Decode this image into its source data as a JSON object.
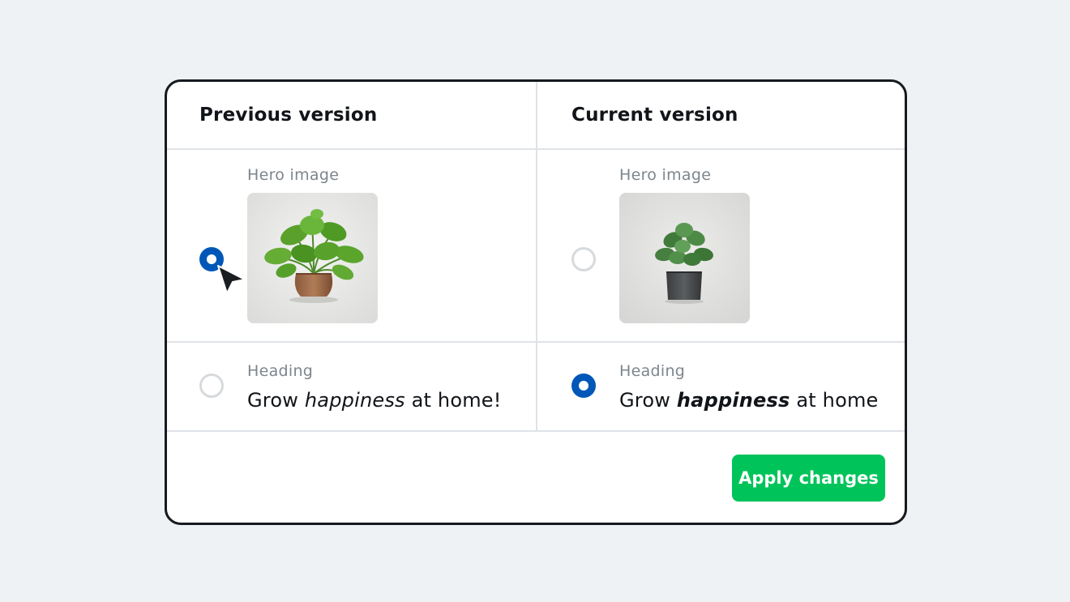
{
  "columns": {
    "previous": {
      "title": "Previous version",
      "hero_label": "Hero image",
      "hero_selected": true,
      "heading_label": "Heading",
      "heading_selected": false,
      "heading": {
        "pre": "Grow ",
        "em": "happiness",
        "post": " at home!"
      }
    },
    "current": {
      "title": "Current version",
      "hero_label": "Hero image",
      "hero_selected": false,
      "heading_label": "Heading",
      "heading_selected": true,
      "heading": {
        "pre": "Grow ",
        "em": "happiness",
        "post": " at home"
      }
    }
  },
  "actions": {
    "apply_label": "Apply changes"
  },
  "icons": {
    "cursor": "arrow-cursor-icon",
    "previous_image": "plant-terracotta-pot-icon",
    "current_image": "plant-grey-pot-icon"
  },
  "colors": {
    "accent": "#0057b8",
    "apply_button": "#00c35a",
    "background": "#eff2f5",
    "card_border": "#16191d",
    "label_muted": "#7d858d"
  }
}
